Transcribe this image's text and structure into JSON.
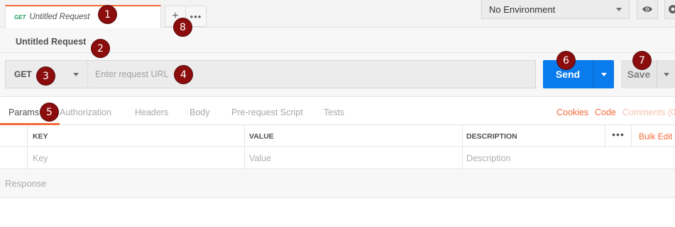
{
  "tab_bar": {
    "request_tab": {
      "method": "GET",
      "title": "Untitled Request"
    },
    "new_tab_glyph": "+",
    "more_glyph": "•••"
  },
  "environment": {
    "selected": "No Environment"
  },
  "request": {
    "name": "Untitled Request",
    "method": "GET",
    "url_placeholder": "Enter request URL",
    "url_value": "",
    "send_label": "Send",
    "save_label": "Save"
  },
  "sub_tabs": [
    {
      "label": "Params",
      "active": true
    },
    {
      "label": "Authorization",
      "active": false
    },
    {
      "label": "Headers",
      "active": false
    },
    {
      "label": "Body",
      "active": false
    },
    {
      "label": "Pre-request Script",
      "active": false
    },
    {
      "label": "Tests",
      "active": false
    }
  ],
  "right_links": {
    "cookies": "Cookies",
    "code": "Code",
    "comments": "Comments (0"
  },
  "params_table": {
    "headers": {
      "key": "KEY",
      "value": "VALUE",
      "description": "DESCRIPTION"
    },
    "placeholders": {
      "key": "Key",
      "value": "Value",
      "description": "Description"
    },
    "more_glyph": "•••",
    "bulk_edit": "Bulk Edit"
  },
  "response": {
    "label": "Response"
  },
  "markers": [
    "1",
    "2",
    "3",
    "4",
    "5",
    "6",
    "7",
    "8"
  ],
  "colors": {
    "accent": "#f26b3a",
    "send_blue": "#097bed",
    "marker": "#8b0d0d",
    "get_green": "#1ea05a"
  },
  "icons": [
    "plus-icon",
    "more-horizontal-icon",
    "eye-icon",
    "gear-icon",
    "chevron-down-icon"
  ]
}
